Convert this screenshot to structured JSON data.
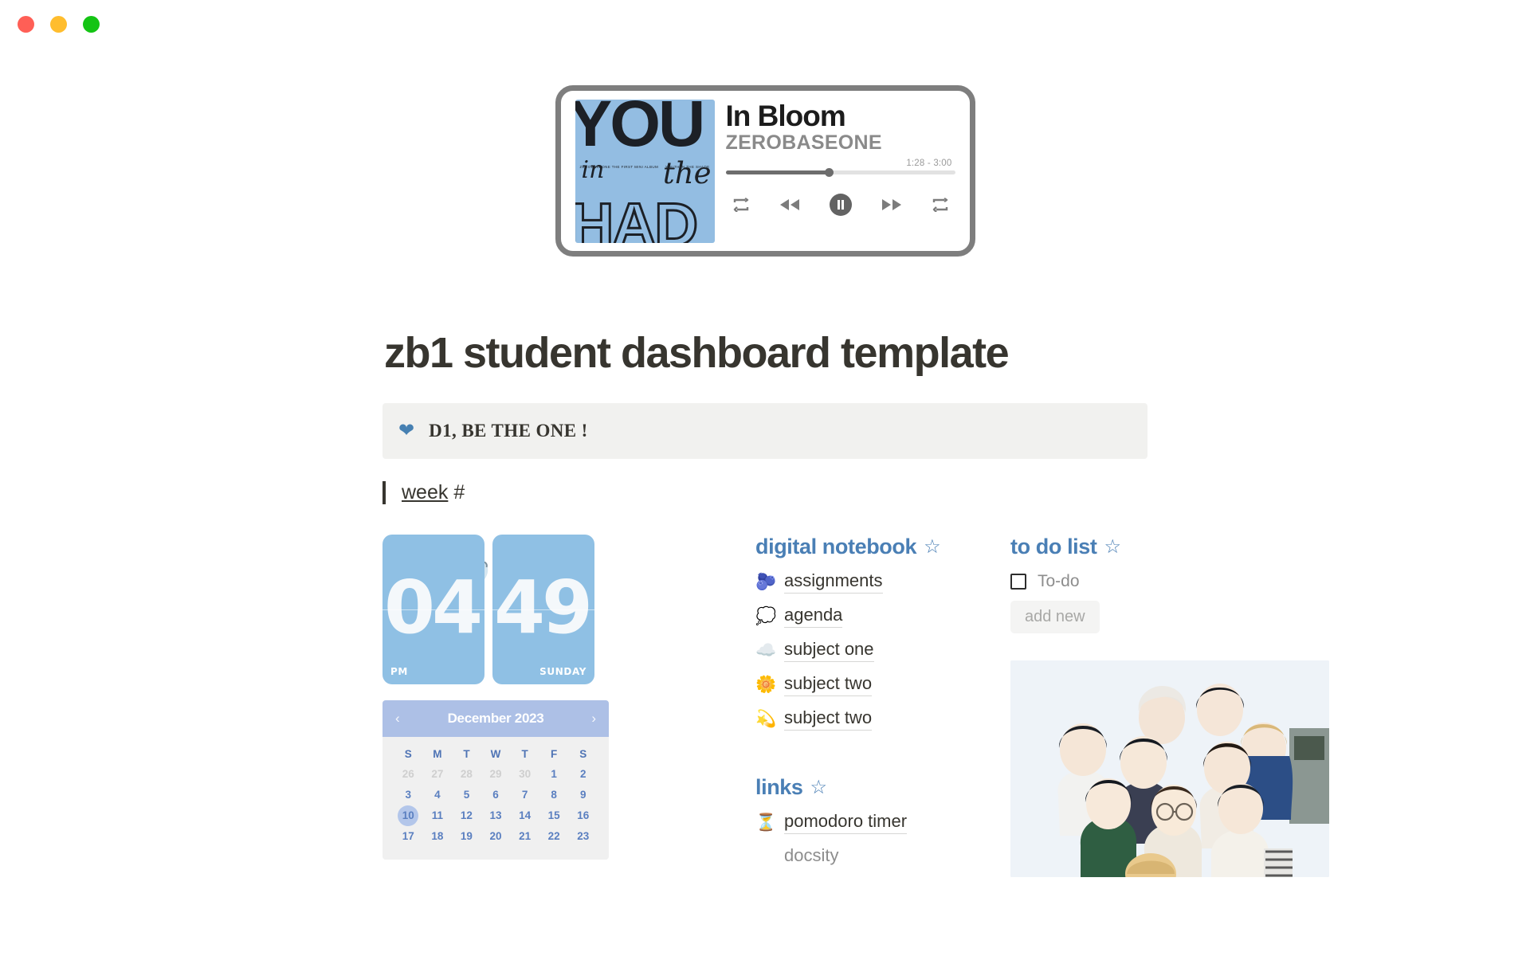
{
  "window": {
    "controls": [
      {
        "name": "close",
        "color": "#ff5f56"
      },
      {
        "name": "minimize",
        "color": "#ffbd2e"
      },
      {
        "name": "maximize",
        "color": "#14c414"
      }
    ]
  },
  "player": {
    "album_art": {
      "line1": "YOU",
      "line2_left": "in",
      "line2_right": "the",
      "line3": "HAD",
      "micro_left": "ZEROBASEONE THE FIRST MINI ALBUM",
      "micro_right": "YOUTH IN THE SHADE",
      "bg_color": "#93bde2"
    },
    "title": "In Bloom",
    "artist": "ZEROBASEONE",
    "time": "1:28 - 3:00",
    "progress_percent": 45,
    "controls": [
      "repeat-icon",
      "rewind-icon",
      "pause-icon",
      "fast-forward-icon",
      "repeat-icon"
    ]
  },
  "decor": {
    "butterfly": "butterfly-image"
  },
  "header": {
    "title": "zb1 student dashboard template",
    "callout": {
      "icon": "blue-heart",
      "text": "D1, BE THE ONE !",
      "bg_color": "#f1f1ef"
    },
    "quote": {
      "underlined": "week",
      "rest": " #"
    }
  },
  "clock": {
    "hour": "04",
    "minute": "49",
    "meridiem": "PM",
    "weekday": "SUNDAY",
    "card_color": "#8fc0e4"
  },
  "calendar": {
    "month_label": "December 2023",
    "prev_icon": "chevron-left-icon",
    "next_icon": "chevron-right-icon",
    "header_color": "#adc0e6",
    "dow": [
      "S",
      "M",
      "T",
      "W",
      "T",
      "F",
      "S"
    ],
    "weeks": [
      [
        {
          "d": "26",
          "mute": true
        },
        {
          "d": "27",
          "mute": true
        },
        {
          "d": "28",
          "mute": true
        },
        {
          "d": "29",
          "mute": true
        },
        {
          "d": "30",
          "mute": true
        },
        {
          "d": "1"
        },
        {
          "d": "2"
        }
      ],
      [
        {
          "d": "3"
        },
        {
          "d": "4"
        },
        {
          "d": "5"
        },
        {
          "d": "6"
        },
        {
          "d": "7"
        },
        {
          "d": "8"
        },
        {
          "d": "9"
        }
      ],
      [
        {
          "d": "10",
          "selected": true
        },
        {
          "d": "11"
        },
        {
          "d": "12"
        },
        {
          "d": "13"
        },
        {
          "d": "14"
        },
        {
          "d": "15"
        },
        {
          "d": "16"
        }
      ],
      [
        {
          "d": "17"
        },
        {
          "d": "18"
        },
        {
          "d": "19"
        },
        {
          "d": "20"
        },
        {
          "d": "21"
        },
        {
          "d": "22"
        },
        {
          "d": "23"
        }
      ]
    ]
  },
  "notebook": {
    "heading": "digital notebook",
    "star": "☆",
    "items": [
      {
        "emoji": "🫐",
        "icon_name": "blueberries-icon",
        "label": "assignments"
      },
      {
        "emoji": "💭",
        "icon_name": "thought-balloon-icon",
        "label": "agenda"
      },
      {
        "emoji": "☁️",
        "icon_name": "cloud-icon",
        "label": "subject one"
      },
      {
        "emoji": "🌼",
        "icon_name": "blossom-icon",
        "label": "subject two"
      },
      {
        "emoji": "💫",
        "icon_name": "dizzy-star-icon",
        "label": "subject two"
      }
    ]
  },
  "links": {
    "heading": "links",
    "star": "☆",
    "items": [
      {
        "emoji": "⏳",
        "icon_name": "hourglass-icon",
        "label": "pomodoro timer"
      },
      {
        "emoji": "",
        "icon_name": "",
        "label": "docsity"
      }
    ]
  },
  "todo": {
    "heading": "to do list",
    "star": "☆",
    "items": [
      {
        "label": "To-do",
        "checked": false
      }
    ],
    "add_button": "add new"
  },
  "group_photo": {
    "name": "zerobaseone-group-photo",
    "member_count": 9
  }
}
